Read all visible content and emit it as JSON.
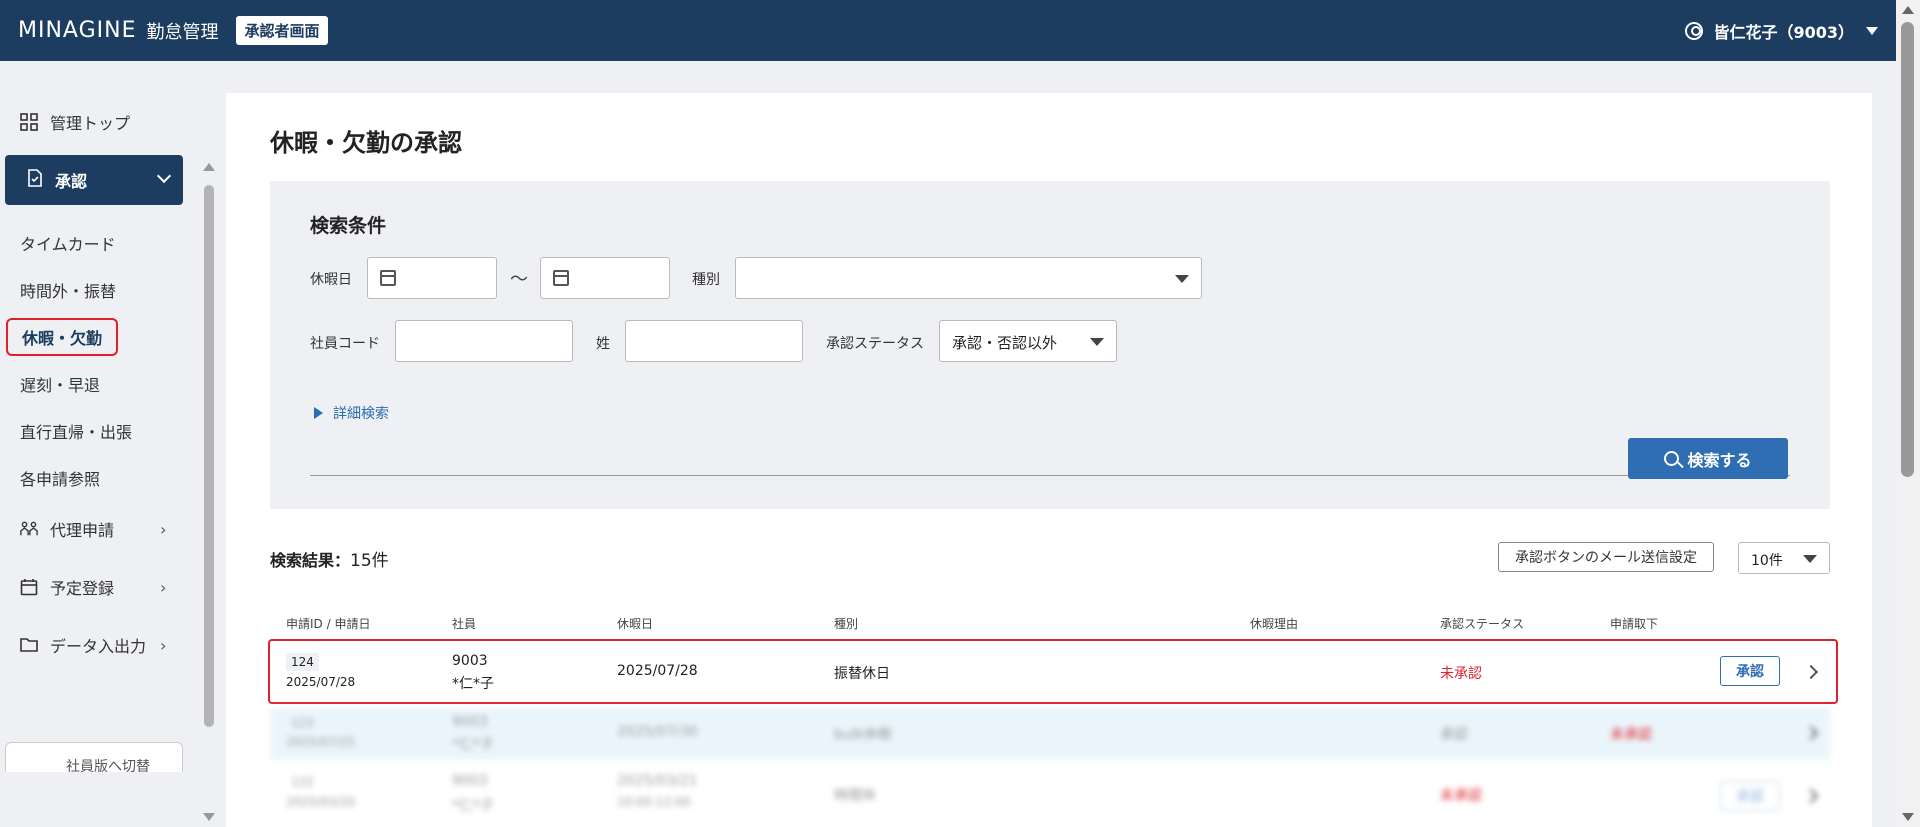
{
  "header": {
    "logo": "MINAGINE",
    "app_name": "勤怠管理",
    "mode_badge": "承認者画面",
    "user_name": "皆仁花子（9003）"
  },
  "sidebar": {
    "top_label": "管理トップ",
    "approve_label": "承認",
    "sub_items": [
      "タイムカード",
      "時間外・振替",
      "休暇・欠勤",
      "遅刻・早退",
      "直行直帰・出張",
      "各申請参照"
    ],
    "active_sub_item": "休暇・欠勤",
    "proxy_label": "代理申請",
    "schedule_label": "予定登録",
    "data_io_label": "データ入出力",
    "switch_label": "社員版へ切替"
  },
  "main": {
    "title": "休暇・欠勤の承認",
    "search": {
      "title": "検索条件",
      "holiday_label": "休暇日",
      "tilde": "～",
      "type_label": "種別",
      "type_value": "",
      "employee_code_label": "社員コード",
      "surname_label": "姓",
      "status_label": "承認ステータス",
      "status_value": "承認・否認以外",
      "detail_link": "詳細検索",
      "search_button": "検索する"
    },
    "results": {
      "label": "検索結果：",
      "count": "15件",
      "mail_button": "承認ボタンのメール送信設定",
      "per_page": "10件",
      "columns": [
        "申請ID / 申請日",
        "社員",
        "休暇日",
        "種別",
        "休暇理由",
        "承認ステータス",
        "申請取下"
      ],
      "rows": [
        {
          "id": "124",
          "date": "2025/07/28",
          "emp_code": "9003",
          "emp_name": "*仁*子",
          "holiday": "2025/07/28",
          "holiday2": "",
          "type": "振替休日",
          "reason": "",
          "status": "未承認",
          "withdraw": "",
          "action": "承認"
        },
        {
          "id": "123",
          "date": "2025/07/25",
          "emp_code": "9003",
          "emp_name": "*仁*子",
          "holiday": "2025/07/30",
          "holiday2": "",
          "type": "bulk休暇",
          "reason": "",
          "status": "承認",
          "withdraw": "未承認",
          "action": ""
        },
        {
          "id": "122",
          "date": "2025/03/20",
          "emp_code": "9003",
          "emp_name": "*仁*子",
          "holiday": "2025/03/21",
          "holiday2": "10:00-12:00",
          "type": "時間休",
          "reason": "",
          "status": "未承認",
          "withdraw": "",
          "action": "承認"
        }
      ]
    }
  },
  "colors": {
    "header_bg": "#1c3d60",
    "primary_button": "#2f6eb3",
    "status_unapproved": "#e0212b",
    "highlight_border": "#e0212b"
  }
}
